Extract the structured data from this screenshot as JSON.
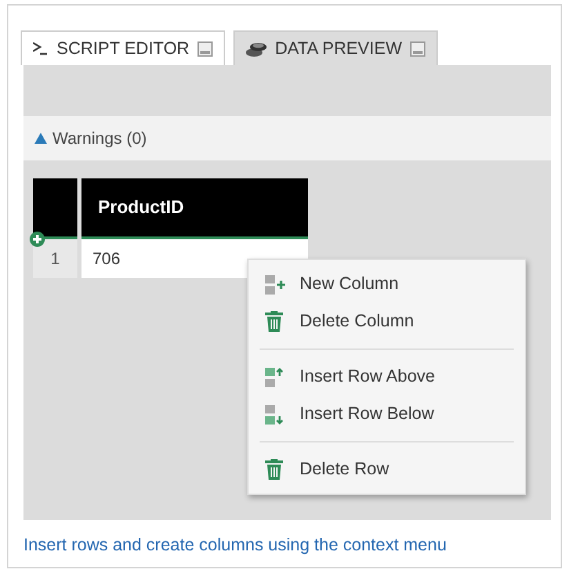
{
  "tabs": [
    {
      "label": "SCRIPT EDITOR",
      "kind": "script",
      "selected": false
    },
    {
      "label": "DATA PREVIEW",
      "kind": "data",
      "selected": true
    }
  ],
  "warnings": {
    "label": "Warnings (0)"
  },
  "table": {
    "columns": [
      "ProductID"
    ],
    "rows": [
      {
        "number": "1",
        "cells": [
          "706"
        ]
      }
    ]
  },
  "context_menu": {
    "groups": [
      [
        {
          "label": "New Column",
          "kind": "new-column"
        },
        {
          "label": "Delete Column",
          "kind": "delete"
        }
      ],
      [
        {
          "label": "Insert Row Above",
          "kind": "insert-above"
        },
        {
          "label": "Insert Row Below",
          "kind": "insert-below"
        }
      ],
      [
        {
          "label": "Delete Row",
          "kind": "delete"
        }
      ]
    ]
  },
  "caption": "Insert rows and create columns using the context menu"
}
